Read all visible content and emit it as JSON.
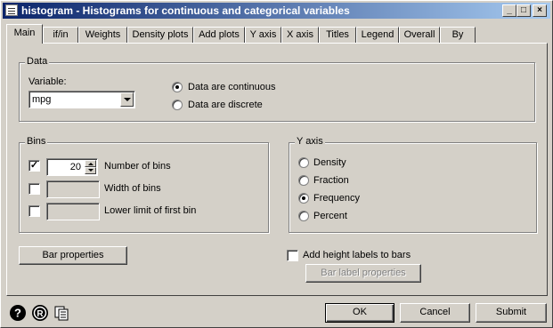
{
  "window": {
    "title": "histogram - Histograms for continuous and categorical variables",
    "controls": [
      "_",
      "□",
      "×"
    ]
  },
  "tabs": [
    "Main",
    "if/in",
    "Weights",
    "Density plots",
    "Add plots",
    "Y axis",
    "X axis",
    "Titles",
    "Legend",
    "Overall",
    "By"
  ],
  "data_group": {
    "label": "Data",
    "variable_label": "Variable:",
    "variable_value": "mpg",
    "continuous_label": "Data are continuous",
    "discrete_label": "Data are discrete",
    "selected": "continuous"
  },
  "bins_group": {
    "label": "Bins",
    "number_of_bins_checked": true,
    "number_of_bins_value": "20",
    "number_of_bins_label": "Number of bins",
    "width_label": "Width of bins",
    "lower_limit_label": "Lower limit of first bin"
  },
  "yaxis_group": {
    "label": "Y axis",
    "options": [
      "Density",
      "Fraction",
      "Frequency",
      "Percent"
    ],
    "selected": "Frequency"
  },
  "bar_properties_label": "Bar properties",
  "height_labels_label": "Add height labels to bars",
  "bar_label_properties_label": "Bar label properties",
  "footer": {
    "ok_label": "OK",
    "cancel_label": "Cancel",
    "submit_label": "Submit"
  },
  "icons": [
    "help-icon",
    "reset-icon",
    "copy-command-icon"
  ]
}
